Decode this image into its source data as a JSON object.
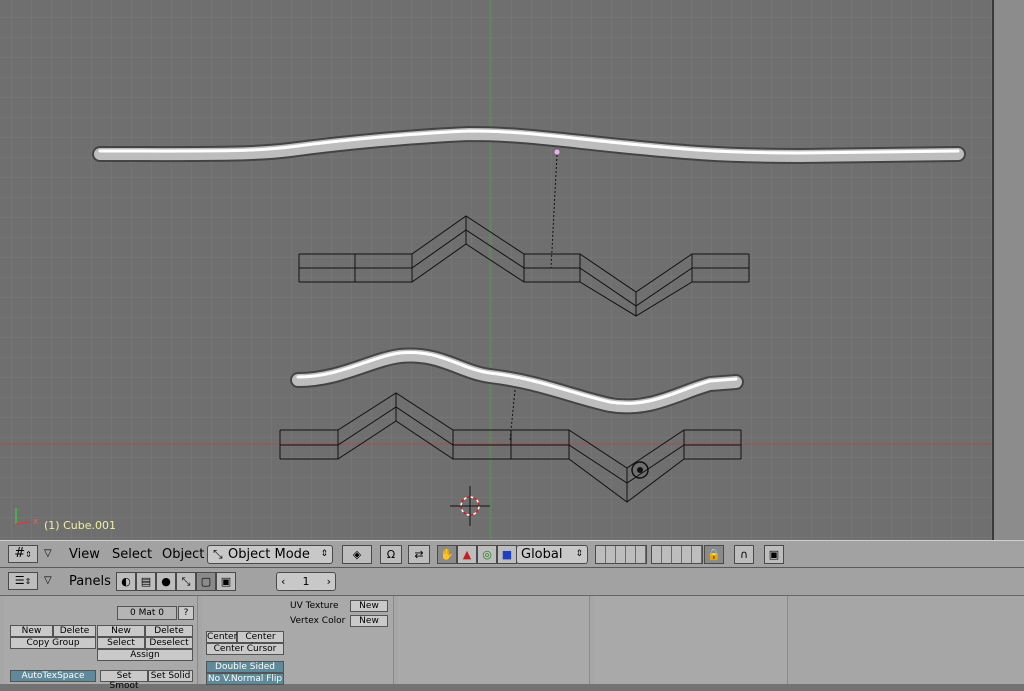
{
  "viewport": {
    "object_label": "(1) Cube.001",
    "axis_x_label": "x"
  },
  "header": {
    "menus": [
      "View",
      "Select",
      "Object"
    ],
    "mode": "Object Mode",
    "orientation": "Global",
    "icons": {
      "window_type": "grid-icon",
      "pivot": "pivot-icon",
      "manipulator": "hand-icon"
    }
  },
  "buttons_window": {
    "panels_label": "Panels",
    "frame_value": "1"
  },
  "panels": {
    "link_materials": {
      "mat_field": "0 Mat 0",
      "help": "?",
      "new_left": "New",
      "delete_left": "Delete",
      "copy_group": "Copy Group",
      "new_right": "New",
      "delete_right": "Delete",
      "select": "Select",
      "deselect": "Deselect",
      "assign": "Assign",
      "autotexspace": "AutoTexSpace",
      "set_smooth": "Set Smoot",
      "set_solid": "Set Solid"
    },
    "mesh": {
      "uv_texture_label": "UV Texture",
      "vertex_color_label": "Vertex Color",
      "new_uv": "New",
      "new_vc": "New",
      "center": "Center",
      "center_new": "Center New",
      "center_cursor": "Center Cursor",
      "double_sided": "Double Sided",
      "no_vnormal_flip": "No V.Normal Flip"
    }
  },
  "colors": {
    "viewport_bg": "#6f6f6f",
    "grid": "#7a7a7a",
    "x_axis": "#a0504a",
    "y_axis": "#4f9a4f",
    "header_bg": "#a2a2a2",
    "highlight_button": "#5e8a99"
  }
}
